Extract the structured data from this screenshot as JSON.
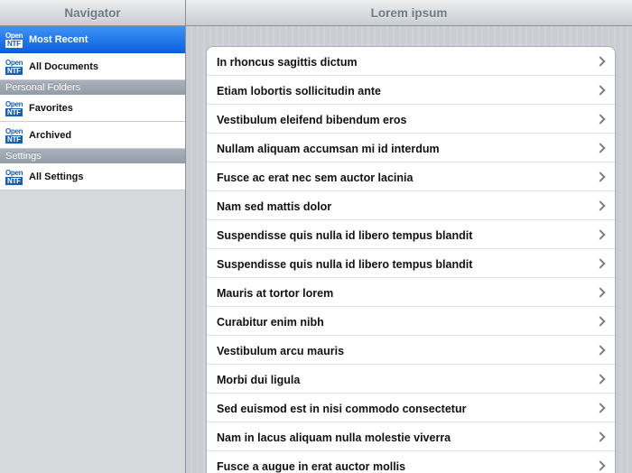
{
  "sidebar": {
    "title": "Navigator",
    "top_items": [
      {
        "label": "Most Recent",
        "selected": true
      },
      {
        "label": "All Documents",
        "selected": false
      }
    ],
    "sections": [
      {
        "title": "Personal Folders",
        "items": [
          {
            "label": "Favorites"
          },
          {
            "label": "Archived"
          }
        ]
      },
      {
        "title": "Settings",
        "items": [
          {
            "label": "All Settings"
          }
        ]
      }
    ],
    "logo_text": {
      "top": "Open",
      "bottom": "NTF"
    }
  },
  "main": {
    "title": "Lorem ipsum",
    "rows": [
      "In rhoncus sagittis dictum",
      "Etiam lobortis sollicitudin ante",
      "Vestibulum eleifend bibendum eros",
      "Nullam aliquam accumsan mi id interdum",
      "Fusce ac erat nec sem auctor lacinia",
      "Nam sed mattis dolor",
      "Suspendisse quis nulla id libero tempus blandit",
      "Suspendisse quis nulla id libero tempus blandit",
      "Mauris at tortor lorem",
      "Curabitur enim nibh",
      "Vestibulum arcu mauris",
      "Morbi dui ligula",
      "Sed euismod est in nisi commodo consectetur",
      "Nam in lacus aliquam nulla molestie viverra",
      "Fusce a augue in erat auctor mollis"
    ]
  },
  "colors": {
    "selected": "#0a61de",
    "brand": "#1a5fa8"
  }
}
